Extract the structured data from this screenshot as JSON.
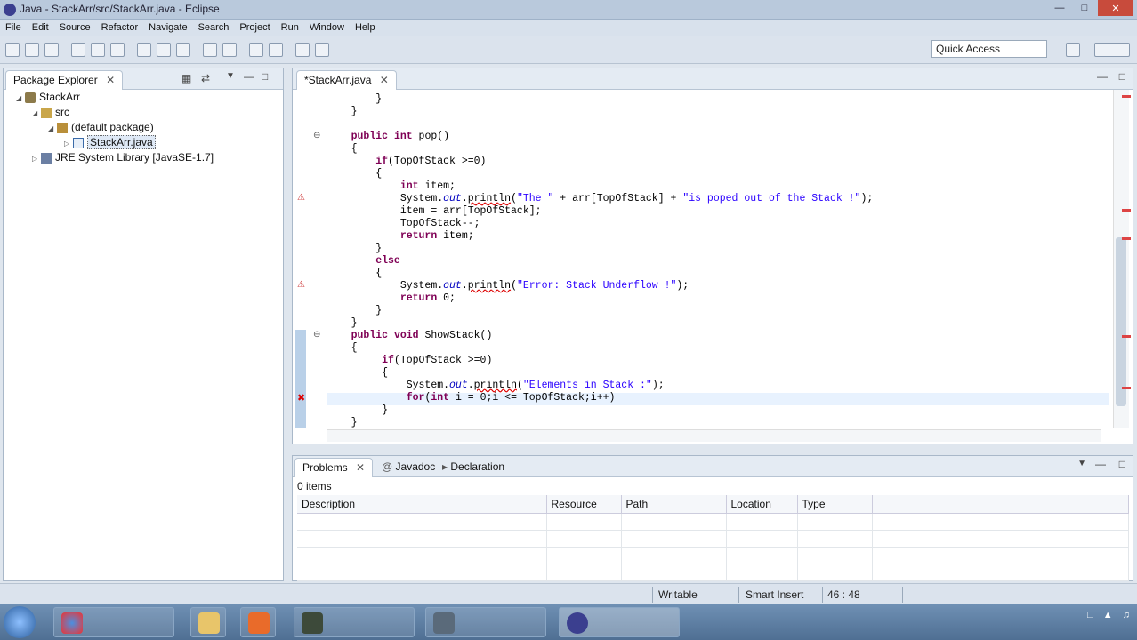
{
  "window": {
    "title": "Java - StackArr/src/StackArr.java - Eclipse"
  },
  "menu": [
    "File",
    "Edit",
    "Source",
    "Refactor",
    "Navigate",
    "Search",
    "Project",
    "Run",
    "Window",
    "Help"
  ],
  "quick_access": {
    "label": "Quick Access"
  },
  "package_explorer": {
    "tab": "Package Explorer",
    "tree": [
      {
        "label": "StackArr"
      },
      {
        "label": "src"
      },
      {
        "label": "(default package)"
      },
      {
        "label": "StackArr.java"
      },
      {
        "label": "JRE System Library [JavaSE-1.7]"
      }
    ]
  },
  "editor": {
    "tab": "*StackArr.java",
    "lines": [
      "        }",
      "    }",
      "",
      "    public int pop()",
      "    {",
      "        if(TopOfStack >=0)",
      "        {",
      "            int item;",
      "            System.out.println(\"The \" + arr[TopOfStack] + \"is poped out of the Stack !\");",
      "            item = arr[TopOfStack];",
      "            TopOfStack--;",
      "            return item;",
      "        }",
      "        else",
      "        {",
      "            System.out.println(\"Error: Stack Underflow !\");",
      "            return 0;",
      "        }",
      "    }",
      "    public void ShowStack()",
      "    {",
      "         if(TopOfStack >=0)",
      "         {",
      "             System.out.println(\"Elements in Stack :\");",
      "             for(int i = 0;i <= TopOfStack;i++)",
      "         }",
      "    }"
    ]
  },
  "problems": {
    "tabs": [
      "Problems",
      "Javadoc",
      "Declaration"
    ],
    "count": "0 items",
    "columns": [
      "Description",
      "Resource",
      "Path",
      "Location",
      "Type"
    ]
  },
  "status": {
    "writable": "Writable",
    "insert_mode": "Smart Insert",
    "position": "46 : 48"
  },
  "colors": {
    "keyword": "#7f0055",
    "string": "#2a00ff",
    "field": "#0000c0"
  }
}
